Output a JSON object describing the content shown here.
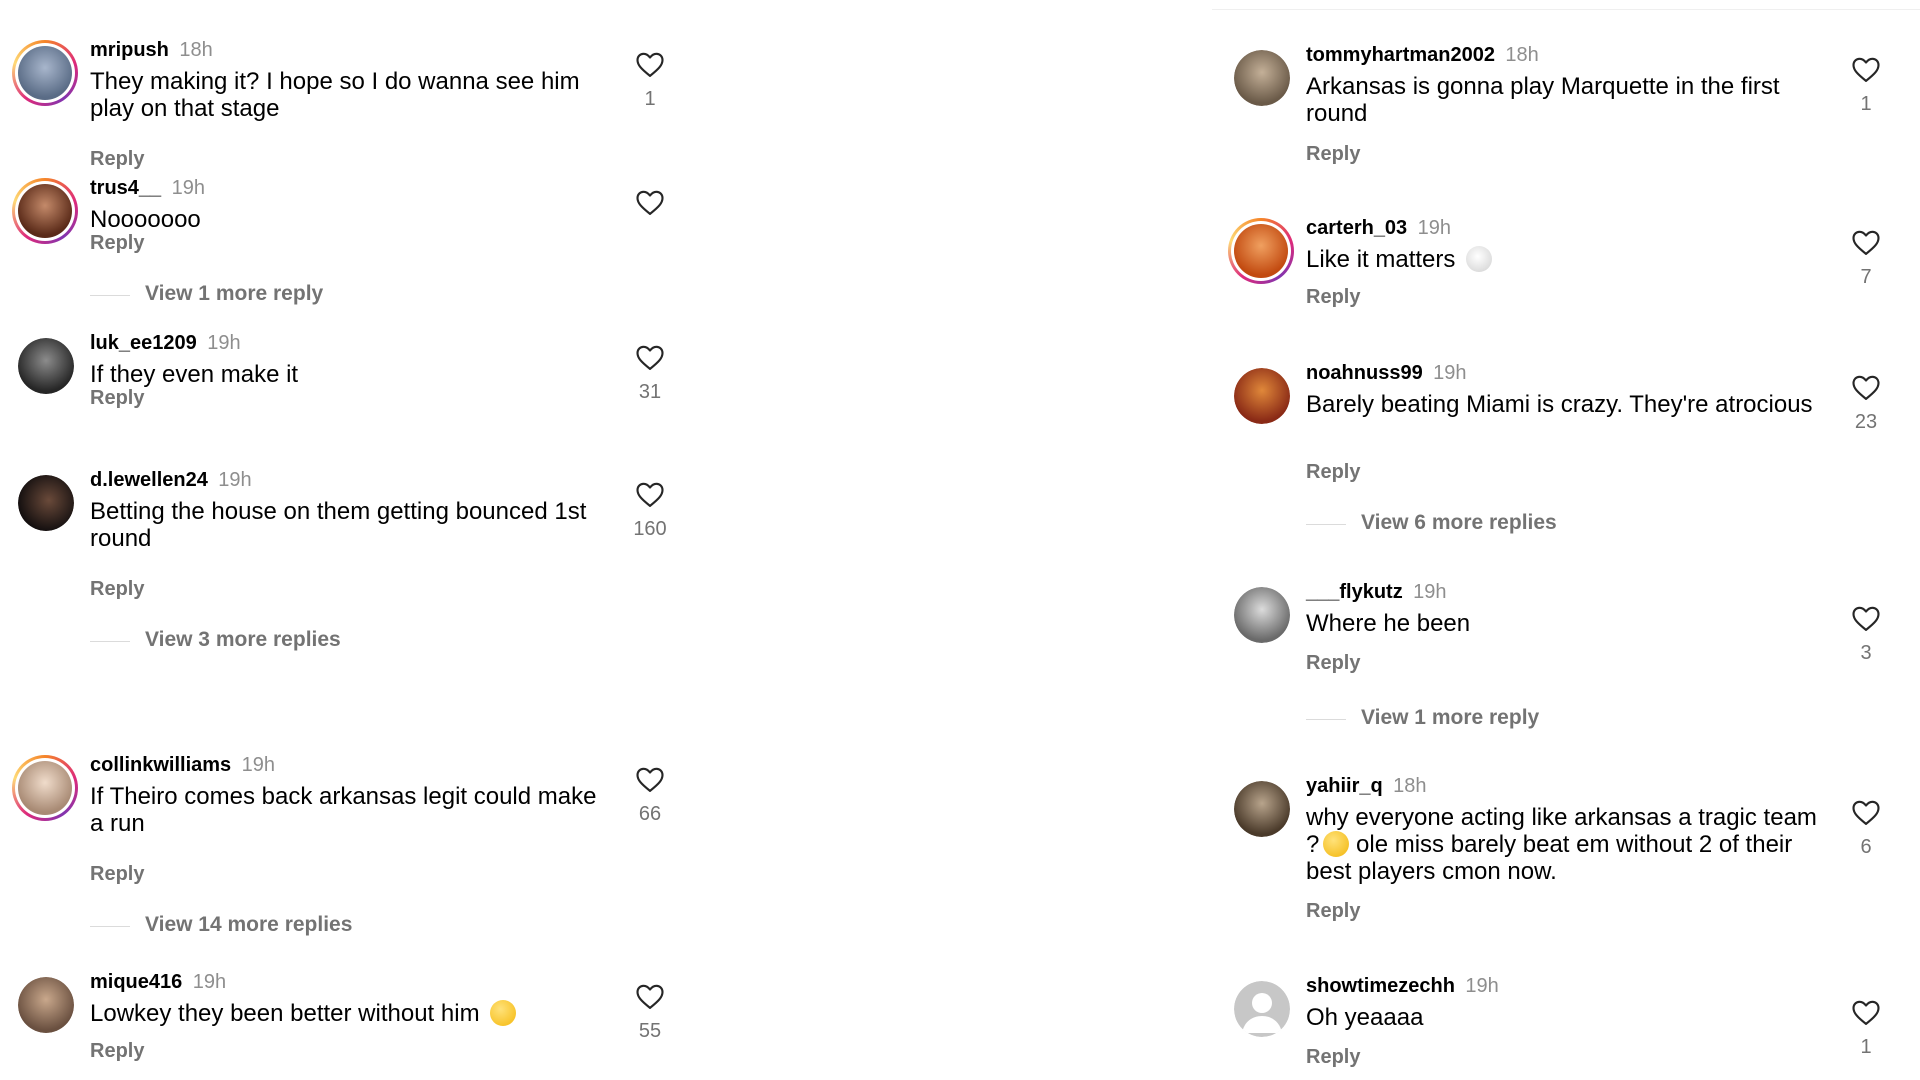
{
  "left": [
    {
      "user": "mripush",
      "time": "18h",
      "text": "They making it? I hope so I do wanna see him play on that stage",
      "likes": "1",
      "reply": "Reply",
      "more": null,
      "story_ring": true,
      "avatar_color": "#5a6c86"
    },
    {
      "user": "trus4__",
      "time": "19h",
      "text": "Nooooooo",
      "likes": "",
      "reply": "Reply",
      "more": "View 1 more reply",
      "story_ring": true,
      "avatar_color": "#8a4d34"
    },
    {
      "user": "luk_ee1209",
      "time": "19h",
      "text": "If they even make it",
      "likes": "31",
      "reply": "Reply",
      "more": null,
      "story_ring": false,
      "avatar_color": "#3b3b3b"
    },
    {
      "user": "d.lewellen24",
      "time": "19h",
      "text": "Betting the house on them getting bounced 1st round",
      "likes": "160",
      "reply": "Reply",
      "more": "View 3 more replies",
      "story_ring": false,
      "avatar_color": "#2a2220"
    },
    {
      "user": "collinkwilliams",
      "time": "19h",
      "text": "If Theiro comes back arkansas legit could make a run",
      "likes": "66",
      "reply": "Reply",
      "more": "View 14 more replies",
      "story_ring": true,
      "avatar_color": "#c9a88c"
    },
    {
      "user": "mique416",
      "time": "19h",
      "text": "Lowkey they been better without him",
      "emoji": "thinking-face",
      "likes": "55",
      "reply": "Reply",
      "more": null,
      "story_ring": false,
      "avatar_color": "#a6866c"
    }
  ],
  "right": [
    {
      "user": "tommyhartman2002",
      "time": "18h",
      "text": "Arkansas is gonna play Marquette in the first round",
      "likes": "1",
      "reply": "Reply",
      "more": null,
      "story_ring": false,
      "avatar_color": "#8a7a66"
    },
    {
      "user": "carterh_03",
      "time": "19h",
      "text": "Like it matters",
      "emoji": "skull",
      "likes": "7",
      "reply": "Reply",
      "more": null,
      "story_ring": true,
      "avatar_color": "#e06a1b"
    },
    {
      "user": "noahnuss99",
      "time": "19h",
      "text": "Barely beating Miami is crazy. They're atrocious",
      "likes": "23",
      "reply": "Reply",
      "more": "View 6 more replies",
      "story_ring": false,
      "avatar_color": "#c94a2a"
    },
    {
      "user": "___flykutz",
      "time": "19h",
      "text": "Where he been",
      "likes": "3",
      "reply": "Reply",
      "more": "View 1 more reply",
      "story_ring": false,
      "avatar_color": "#9a9a9a"
    },
    {
      "user": "yahiir_q",
      "time": "18h",
      "text_a": "why everyone acting like arkansas a tragic team ?",
      "emoji": "crying-face",
      "text_b": " ole miss barely beat em without 2 of their best players cmon now.",
      "likes": "6",
      "reply": "Reply",
      "more": null,
      "story_ring": false,
      "avatar_color": "#6a5a48"
    },
    {
      "user": "showtimezechh",
      "time": "19h",
      "text": "Oh yeaaaa",
      "likes": "1",
      "reply": "Reply",
      "more": null,
      "story_ring": false,
      "avatar_color": "#c7c7c7"
    }
  ]
}
